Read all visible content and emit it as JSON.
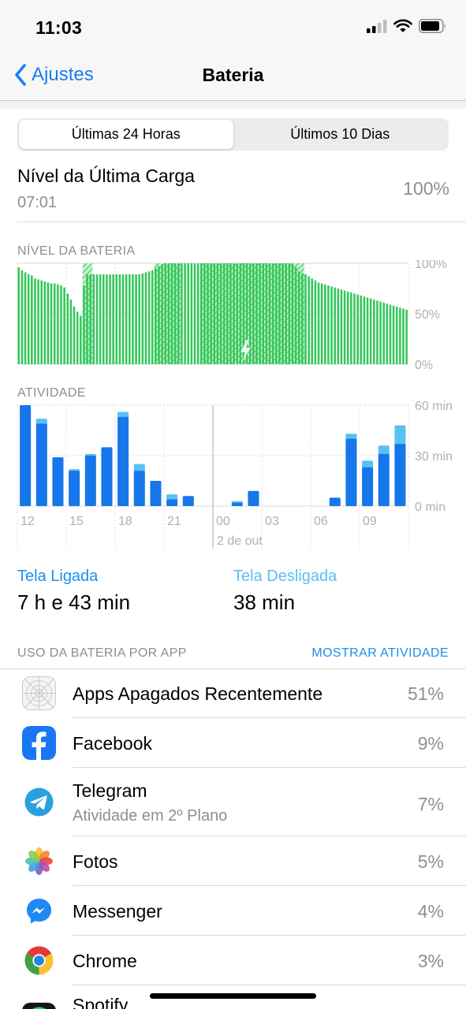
{
  "status_bar": {
    "time": "11:03"
  },
  "nav": {
    "back_label": "Ajustes",
    "title": "Bateria"
  },
  "segments": [
    "Últimas 24 Horas",
    "Últimos 10 Dias"
  ],
  "last_charge": {
    "title": "Nível da Última Carga",
    "time": "07:01",
    "percent": "100%"
  },
  "battery_section": {
    "label": "NÍVEL DA BATERIA",
    "y_ticks": [
      "100%",
      "50%",
      "0%"
    ]
  },
  "activity_section": {
    "label": "ATIVIDADE",
    "y_ticks": [
      "60 min",
      "30 min",
      "0 min"
    ]
  },
  "x_ticks": [
    "12",
    "15",
    "18",
    "21",
    "00",
    "03",
    "06",
    "09"
  ],
  "x_date_label": "2 de out",
  "screen_on": {
    "label": "Tela Ligada",
    "value": "7 h e 43 min"
  },
  "screen_off": {
    "label": "Tela Desligada",
    "value": "38 min"
  },
  "usage_header": {
    "label": "USO DA BATERIA POR APP",
    "action": "MOSTRAR ATIVIDADE"
  },
  "apps": [
    {
      "name": "Apps Apagados Recentemente",
      "sub": "",
      "pct": "51%",
      "icon": "deleted-apps-icon"
    },
    {
      "name": "Facebook",
      "sub": "",
      "pct": "9%",
      "icon": "facebook-icon"
    },
    {
      "name": "Telegram",
      "sub": "Atividade em 2º Plano",
      "pct": "7%",
      "icon": "telegram-icon"
    },
    {
      "name": "Fotos",
      "sub": "",
      "pct": "5%",
      "icon": "photos-icon"
    },
    {
      "name": "Messenger",
      "sub": "",
      "pct": "4%",
      "icon": "messenger-icon"
    },
    {
      "name": "Chrome",
      "sub": "",
      "pct": "3%",
      "icon": "chrome-icon"
    },
    {
      "name": "Spotify",
      "sub": "",
      "pct": "",
      "icon": "spotify-icon"
    }
  ],
  "colors": {
    "accent": "#1a7cf2",
    "battery_green": "#35c759",
    "activity_on": "#1676ea",
    "activity_off": "#5ac1f5"
  },
  "chart_data": [
    {
      "type": "bar",
      "title": "NÍVEL DA BATERIA",
      "ylim": [
        0,
        100
      ],
      "unit": "%",
      "values": [
        96,
        93,
        91,
        89,
        88,
        85,
        84,
        83,
        82,
        81,
        80,
        80,
        79,
        78,
        76,
        70,
        64,
        57,
        52,
        48,
        78,
        89,
        89,
        89,
        89,
        89,
        89,
        89,
        89,
        89,
        89,
        89,
        89,
        89,
        89,
        89,
        89,
        89,
        90,
        91,
        92,
        93,
        95,
        97,
        99,
        100,
        100,
        100,
        100,
        100,
        100,
        100,
        100,
        100,
        100,
        100,
        100,
        100,
        100,
        100,
        100,
        100,
        100,
        100,
        100,
        100,
        100,
        100,
        100,
        100,
        100,
        100,
        100,
        100,
        100,
        100,
        100,
        100,
        100,
        100,
        100,
        100,
        100,
        100,
        100,
        96,
        92,
        90,
        89,
        87,
        85,
        83,
        81,
        80,
        79,
        78,
        77,
        76,
        75,
        74,
        73,
        72,
        71,
        70,
        69,
        68,
        67,
        66,
        65,
        64,
        63,
        62,
        61,
        60,
        59,
        58,
        57,
        56,
        55,
        54
      ],
      "charging_ranges": [
        [
          20,
          22
        ],
        [
          42,
          49
        ],
        [
          56,
          87
        ]
      ]
    },
    {
      "type": "bar",
      "title": "ATIVIDADE",
      "ylim": [
        0,
        60
      ],
      "unit": "min",
      "x": [
        "12",
        "15",
        "18",
        "21",
        "00",
        "03",
        "06",
        "09"
      ],
      "series": [
        {
          "name": "Tela Ligada",
          "values": [
            60,
            49,
            29,
            21,
            30,
            35,
            53,
            21,
            15,
            4,
            6,
            null,
            null,
            2,
            9,
            null,
            null,
            null,
            null,
            5,
            40,
            23,
            31,
            37
          ]
        },
        {
          "name": "Tela Desligada",
          "values": [
            0,
            3,
            0,
            1,
            1,
            0,
            3,
            4,
            0,
            3,
            0,
            null,
            null,
            1,
            0,
            null,
            null,
            null,
            null,
            0,
            3,
            4,
            5,
            11
          ]
        }
      ]
    }
  ]
}
